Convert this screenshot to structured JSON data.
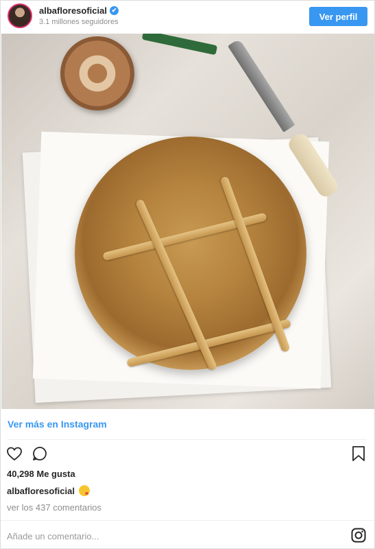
{
  "header": {
    "username": "albafloresoficial",
    "verified_mark": "✔",
    "followers": "3.1 millones seguidores",
    "profile_button": "Ver perfil"
  },
  "post": {
    "view_more_link": "Ver más en Instagram",
    "likes": "40,298 Me gusta",
    "caption_user": "albafloresoficial",
    "caption_emoji": "face-savoring-food-emoji",
    "comments_link": "ver los 437 comentarios",
    "add_comment_placeholder": "Añade un comentario..."
  },
  "colors": {
    "accent_blue": "#3897f0",
    "text": "#262626",
    "muted": "#8e8e8e"
  },
  "icons": {
    "like": "heart-icon",
    "comment": "comment-icon",
    "save": "bookmark-icon",
    "brand": "instagram-icon"
  }
}
